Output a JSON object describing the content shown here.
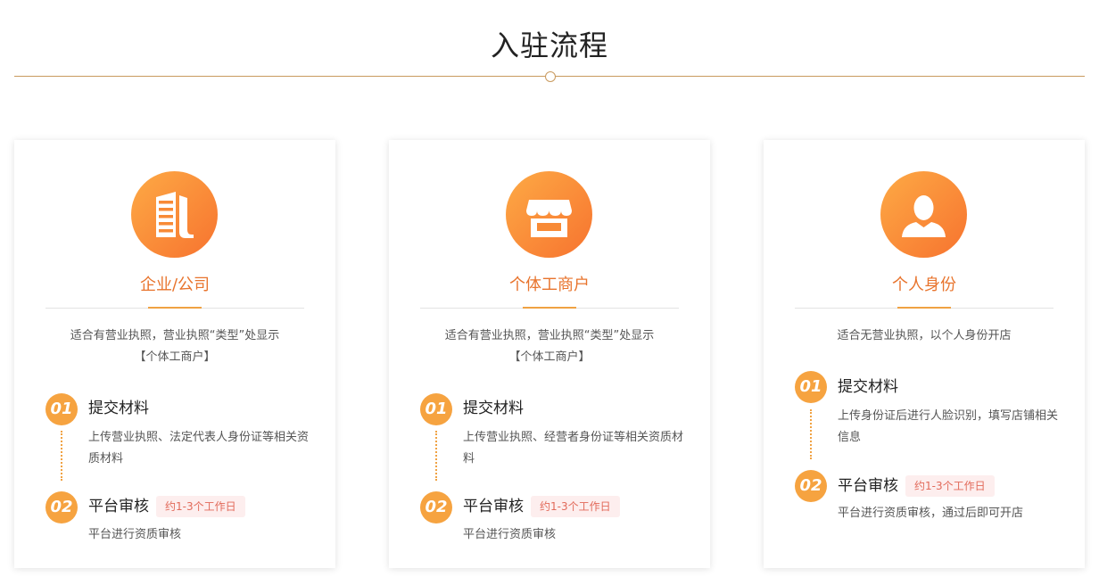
{
  "header": {
    "title": "入驻流程"
  },
  "cards": [
    {
      "title": "企业/公司",
      "icon": "building-icon",
      "desc_line1": "适合有营业执照，营业执照“类型”处显示",
      "desc_line2": "【个体工商户】",
      "steps": [
        {
          "num": "01",
          "title": "提交材料",
          "desc": "上传营业执照、法定代表人身份证等相关资质材料"
        },
        {
          "num": "02",
          "title": "平台审核",
          "tag": "约1-3个工作日",
          "desc": "平台进行资质审核"
        }
      ]
    },
    {
      "title": "个体工商户",
      "icon": "storefront-icon",
      "desc_line1": "适合有营业执照，营业执照“类型”处显示",
      "desc_line2": "【个体工商户】",
      "steps": [
        {
          "num": "01",
          "title": "提交材料",
          "desc": "上传营业执照、经营者身份证等相关资质材料"
        },
        {
          "num": "02",
          "title": "平台审核",
          "tag": "约1-3个工作日",
          "desc": "平台进行资质审核"
        }
      ]
    },
    {
      "title": "个人身份",
      "icon": "person-icon",
      "desc_line1": "适合无营业执照，以个人身份开店",
      "steps": [
        {
          "num": "01",
          "title": "提交材料",
          "desc": "上传身份证后进行人脸识别，填写店铺相关信息"
        },
        {
          "num": "02",
          "title": "平台审核",
          "tag": "约1-3个工作日",
          "desc": "平台进行资质审核，通过后即可开店"
        }
      ]
    }
  ],
  "colors": {
    "accent": "#e8742d",
    "badge": "#f6a340",
    "rule": "#c99a5e",
    "tag_bg": "#fdeeee",
    "tag_text": "#e26a5a"
  }
}
